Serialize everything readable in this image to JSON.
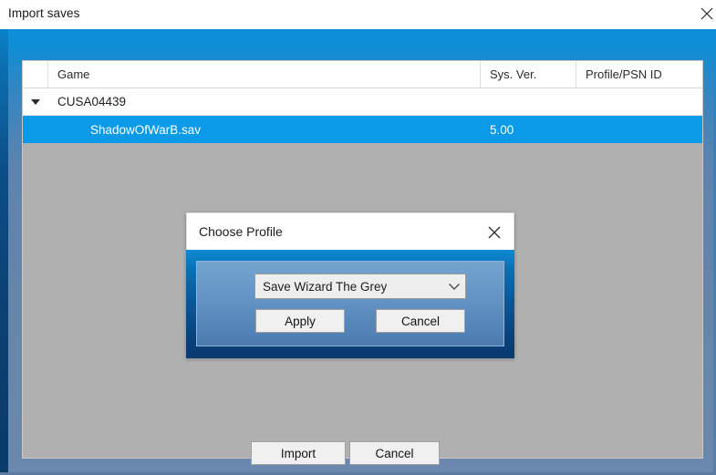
{
  "host_window": {
    "title": "Import saves",
    "close_icon": "close-icon"
  },
  "save_list": {
    "columns": [
      {
        "key": "spacer",
        "label": ""
      },
      {
        "key": "game",
        "label": "Game"
      },
      {
        "key": "sys",
        "label": "Sys. Ver."
      },
      {
        "key": "psn",
        "label": "Profile/PSN ID"
      }
    ],
    "rows": [
      {
        "type": "group",
        "expander_icon": "triangle-down-icon",
        "game": "CUSA04439",
        "sys": "",
        "psn": "",
        "selected": false
      },
      {
        "type": "save",
        "game": "ShadowOfWarB.sav",
        "sys": "5.00",
        "psn": "",
        "selected": true
      }
    ],
    "selection_color": "#0a9ae8",
    "empty_area_color": "#b0b0b0"
  },
  "actions": {
    "import_label": "Import",
    "cancel_label": "Cancel"
  },
  "modal": {
    "title": "Choose Profile",
    "close_icon": "close-icon",
    "profile_dropdown": {
      "value": "Save Wizard The Grey",
      "chevron_icon": "chevron-down-icon"
    },
    "apply_label": "Apply",
    "cancel_label": "Cancel"
  },
  "theme": {
    "window_blue_top": "#0d8ed7",
    "window_blue_bottom": "#6b87ad",
    "modal_frame_blue": "#0b8ad2",
    "modal_panel_blue": "#5f8ec0"
  }
}
